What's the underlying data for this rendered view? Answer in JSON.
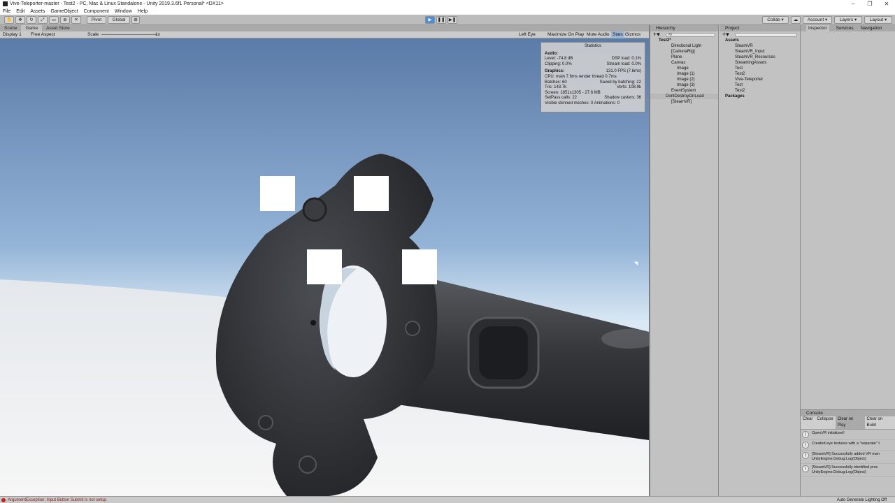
{
  "window": {
    "title": "Vive-Teleporter-master - Test2 - PC, Mac & Linux Standalone - Unity 2019.3.6f1 Personal* <DX11>",
    "controls": [
      "–",
      "❐",
      "✕"
    ]
  },
  "menu": [
    "File",
    "Edit",
    "Assets",
    "GameObject",
    "Component",
    "Window",
    "Help"
  ],
  "toolbar": {
    "pivot": "Pivot",
    "global": "Global",
    "play": "▶",
    "pause": "❚❚",
    "step": "▶❚",
    "collab": "Collab ▾",
    "cloud": "☁",
    "account": "Account ▾",
    "layers": "Layers ▾",
    "layout": "Layout ▾"
  },
  "view_tabs": [
    "Scene",
    "Game",
    "Asset Store"
  ],
  "gamebar": {
    "display": "Display 1",
    "aspect": "Free Aspect",
    "scale_label": "Scale",
    "scale_value": "1x",
    "left_eye": "Left Eye",
    "maximize": "Maximize On Play",
    "mute": "Mute Audio",
    "stats": "Stats",
    "gizmos": "Gizmos"
  },
  "stats": {
    "title": "Statistics",
    "audio_header": "Audio:",
    "level": "Level: -74.8 dB",
    "dsp": "DSP load: 0.1%",
    "clipping": "Clipping: 0.0%",
    "stream": "Stream load: 0.0%",
    "graphics_header": "Graphics:",
    "fps": "131.0 FPS (7.6ms)",
    "cpu": "CPU: main 7.6ms  render thread 0.7ms",
    "batches": "Batches: 60",
    "saved": "Saved by batching: 22",
    "tris": "Tris: 143.7k",
    "verts": "Verts: 108.9k",
    "screen": "Screen: 1851x1305 - 27.6 MB",
    "setpass": "SetPass calls: 22",
    "shadow": "Shadow casters: 36",
    "skinned": "Visible skinned meshes: 0  Animations: 0"
  },
  "hierarchy": {
    "tab": "Hierarchy",
    "search_placeholder": "All",
    "items": [
      "Test2*",
      "Directional Light",
      "[CameraRig]",
      "Plane",
      "Canvas",
      "Image",
      "Image (1)",
      "Image (2)",
      "Image (3)",
      "EventSystem",
      "DontDestroyOnLoad",
      "[SteamVR]"
    ]
  },
  "project": {
    "tab": "Project",
    "items": [
      "Assets",
      "SteamVR",
      "SteamVR_Input",
      "SteamVR_Resources",
      "StreamingAssets",
      "Test",
      "Test2",
      "Vive-Teleporter",
      "Test",
      "Test2",
      "Packages"
    ]
  },
  "inspector": {
    "tabs": [
      "Inspector",
      "Services",
      "Navigation"
    ]
  },
  "console": {
    "tab": "Console",
    "buttons": [
      "Clear",
      "Collapse",
      "Clear on Play",
      "Clear on Build"
    ],
    "entries": [
      {
        "line1": "OpenVR initialized!",
        "line2": ""
      },
      {
        "line1": "Created eye textures with a \"separate\" t",
        "line2": ""
      },
      {
        "line1": "[SteamVR] Successfully added VR man",
        "line2": "UnityEngine.Debug:Log(Object)"
      },
      {
        "line1": "[SteamVR] Successfully identified proc",
        "line2": "UnityEngine.Debug:Log(Object)"
      }
    ]
  },
  "status": {
    "error": "ArgumentException: Input Button Submit is not setup.",
    "lighting": "Auto Generate Lighting Off"
  },
  "colors": {
    "sky_top": "#5f7fae",
    "sky_bottom": "#dde9f3",
    "controller": "#2c2e31",
    "error": "#c42020"
  }
}
